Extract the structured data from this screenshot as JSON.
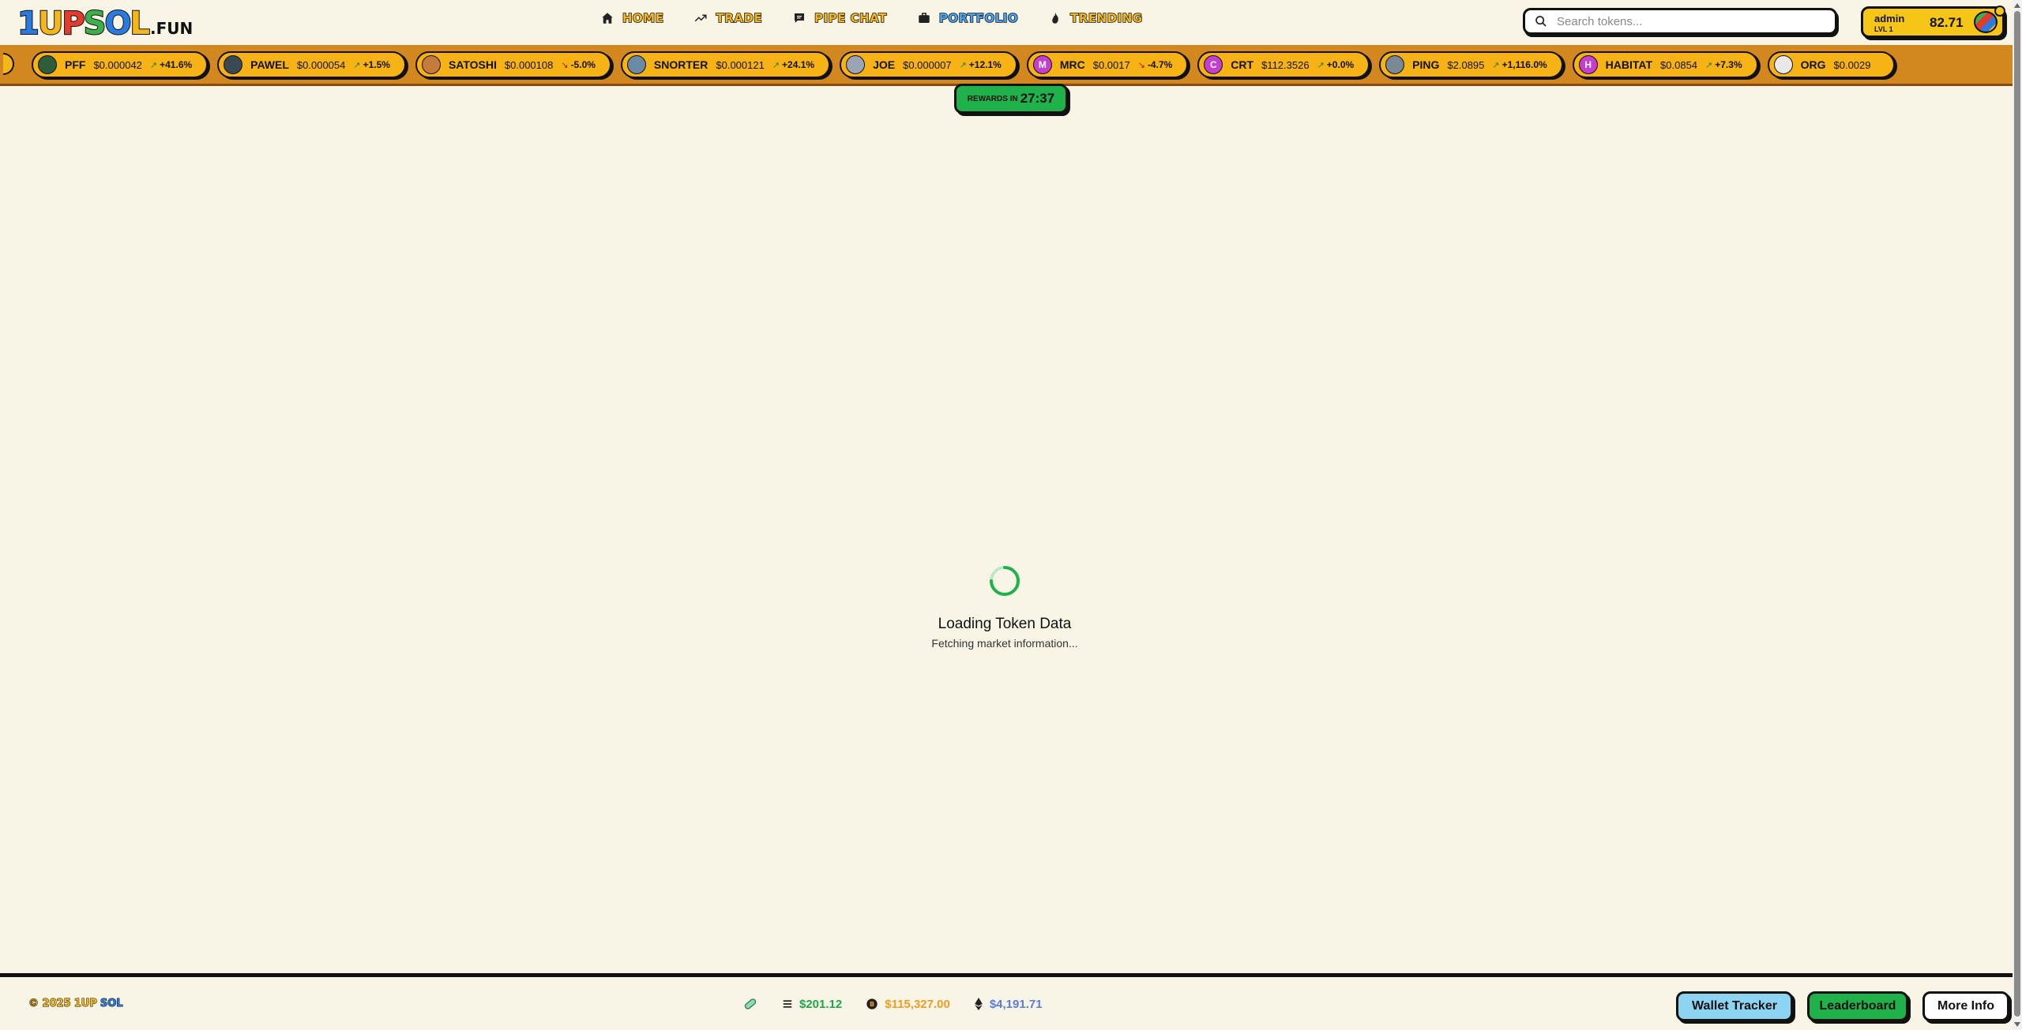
{
  "header": {
    "logo": {
      "part1": "1",
      "part2": "U",
      "part3": "P",
      "part4": "S",
      "part5": "O",
      "part6": "L",
      "suffix": ".FUN"
    },
    "nav": [
      {
        "label": "HOME",
        "icon": "home-icon"
      },
      {
        "label": "TRADE",
        "icon": "trend-up-icon"
      },
      {
        "label": "PIPE CHAT",
        "icon": "chat-icon"
      },
      {
        "label": "PORTFOLIO",
        "icon": "briefcase-icon"
      },
      {
        "label": "TRENDING",
        "icon": "flame-icon"
      }
    ],
    "search": {
      "placeholder": "Search tokens..."
    },
    "account": {
      "username": "admin",
      "level": "LVL 1",
      "balance": "82.71"
    }
  },
  "ticker": [
    {
      "symbol": "PFF",
      "price": "$0.000042",
      "change": "+41.6%",
      "trend": "up",
      "avatar_color": "#2f5d3a",
      "avatar_text": ""
    },
    {
      "symbol": "PAWEL",
      "price": "$0.000054",
      "change": "+1.5%",
      "trend": "up",
      "avatar_color": "#3a4a55",
      "avatar_text": ""
    },
    {
      "symbol": "SATOSHI",
      "price": "$0.000108",
      "change": "-5.0%",
      "trend": "down",
      "avatar_color": "#c57b3a",
      "avatar_text": ""
    },
    {
      "symbol": "SNORTER",
      "price": "$0.000121",
      "change": "+24.1%",
      "trend": "up",
      "avatar_color": "#6b8aa5",
      "avatar_text": ""
    },
    {
      "symbol": "JOE",
      "price": "$0.000007",
      "change": "+12.1%",
      "trend": "up",
      "avatar_color": "#9aa4b5",
      "avatar_text": ""
    },
    {
      "symbol": "MRC",
      "price": "$0.0017",
      "change": "-4.7%",
      "trend": "down",
      "avatar_color": "#c43fd0",
      "avatar_text": "M"
    },
    {
      "symbol": "CRT",
      "price": "$112.3526",
      "change": "+0.0%",
      "trend": "up",
      "avatar_color": "#c43fd0",
      "avatar_text": "C"
    },
    {
      "symbol": "PING",
      "price": "$2.0895",
      "change": "+1,116.0%",
      "trend": "up",
      "avatar_color": "#7a8a95",
      "avatar_text": ""
    },
    {
      "symbol": "HABITAT",
      "price": "$0.0854",
      "change": "+7.3%",
      "trend": "up",
      "avatar_color": "#c43fd0",
      "avatar_text": "H"
    },
    {
      "symbol": "ORG",
      "price": "$0.0029",
      "change": "",
      "trend": "up",
      "avatar_color": "#e8e8e8",
      "avatar_text": ""
    }
  ],
  "rewards": {
    "label": "REWARDS IN",
    "time": "27:37"
  },
  "loading": {
    "title": "Loading Token Data",
    "subtitle": "Fetching market information..."
  },
  "footer": {
    "copyright": {
      "year": "© 2025",
      "brand1": "1UP",
      "brand2": "SOL"
    },
    "prices": [
      {
        "icon": "solana-icon",
        "value": "$201.12"
      },
      {
        "icon": "bitcoin-icon",
        "value": "$115,327.00"
      },
      {
        "icon": "ethereum-icon",
        "value": "$4,191.71"
      }
    ],
    "buttons": {
      "wallet_tracker": "Wallet Tracker",
      "leaderboard": "Leaderboard",
      "more_info": "More Info"
    }
  },
  "colors": {
    "background": "#f8f4e6",
    "ticker": "#d3871f",
    "pill": "#f7b215",
    "green": "#1fb24a",
    "sky": "#8dd3f2"
  }
}
